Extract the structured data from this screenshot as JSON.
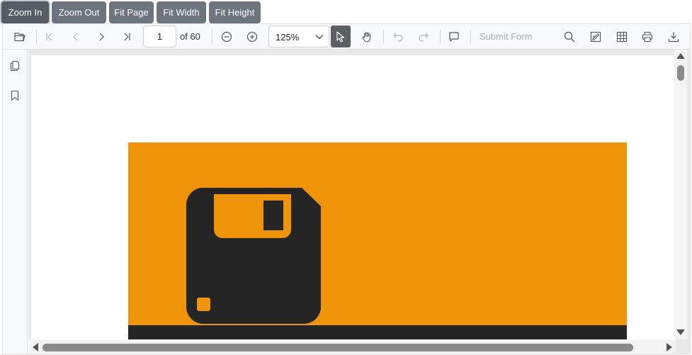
{
  "zoom_buttons": [
    {
      "label": "Zoom In",
      "active": true
    },
    {
      "label": "Zoom Out",
      "active": false
    },
    {
      "label": "Fit Page",
      "active": false
    },
    {
      "label": "Fit Width",
      "active": false
    },
    {
      "label": "Fit Height",
      "active": false
    }
  ],
  "toolbar": {
    "current_page": "1",
    "page_count_label": "of 60",
    "zoom_value": "125%",
    "submit_form_label": "Submit Form",
    "icons": [
      "open-file-icon",
      "first-page-icon",
      "previous-page-icon",
      "next-page-icon",
      "last-page-icon",
      "zoom-out-icon",
      "zoom-in-icon",
      "text-select-icon",
      "pan-icon",
      "undo-icon",
      "redo-icon",
      "comment-icon",
      "search-icon",
      "annotation-edit-icon",
      "form-designer-icon",
      "print-icon",
      "download-icon"
    ]
  },
  "nav_pane": {
    "icons": [
      "page-thumbnails-icon",
      "bookmark-icon"
    ]
  },
  "colors": {
    "button_bg": "#6c757d",
    "banner": "#ef9409",
    "disk": "#252525"
  }
}
